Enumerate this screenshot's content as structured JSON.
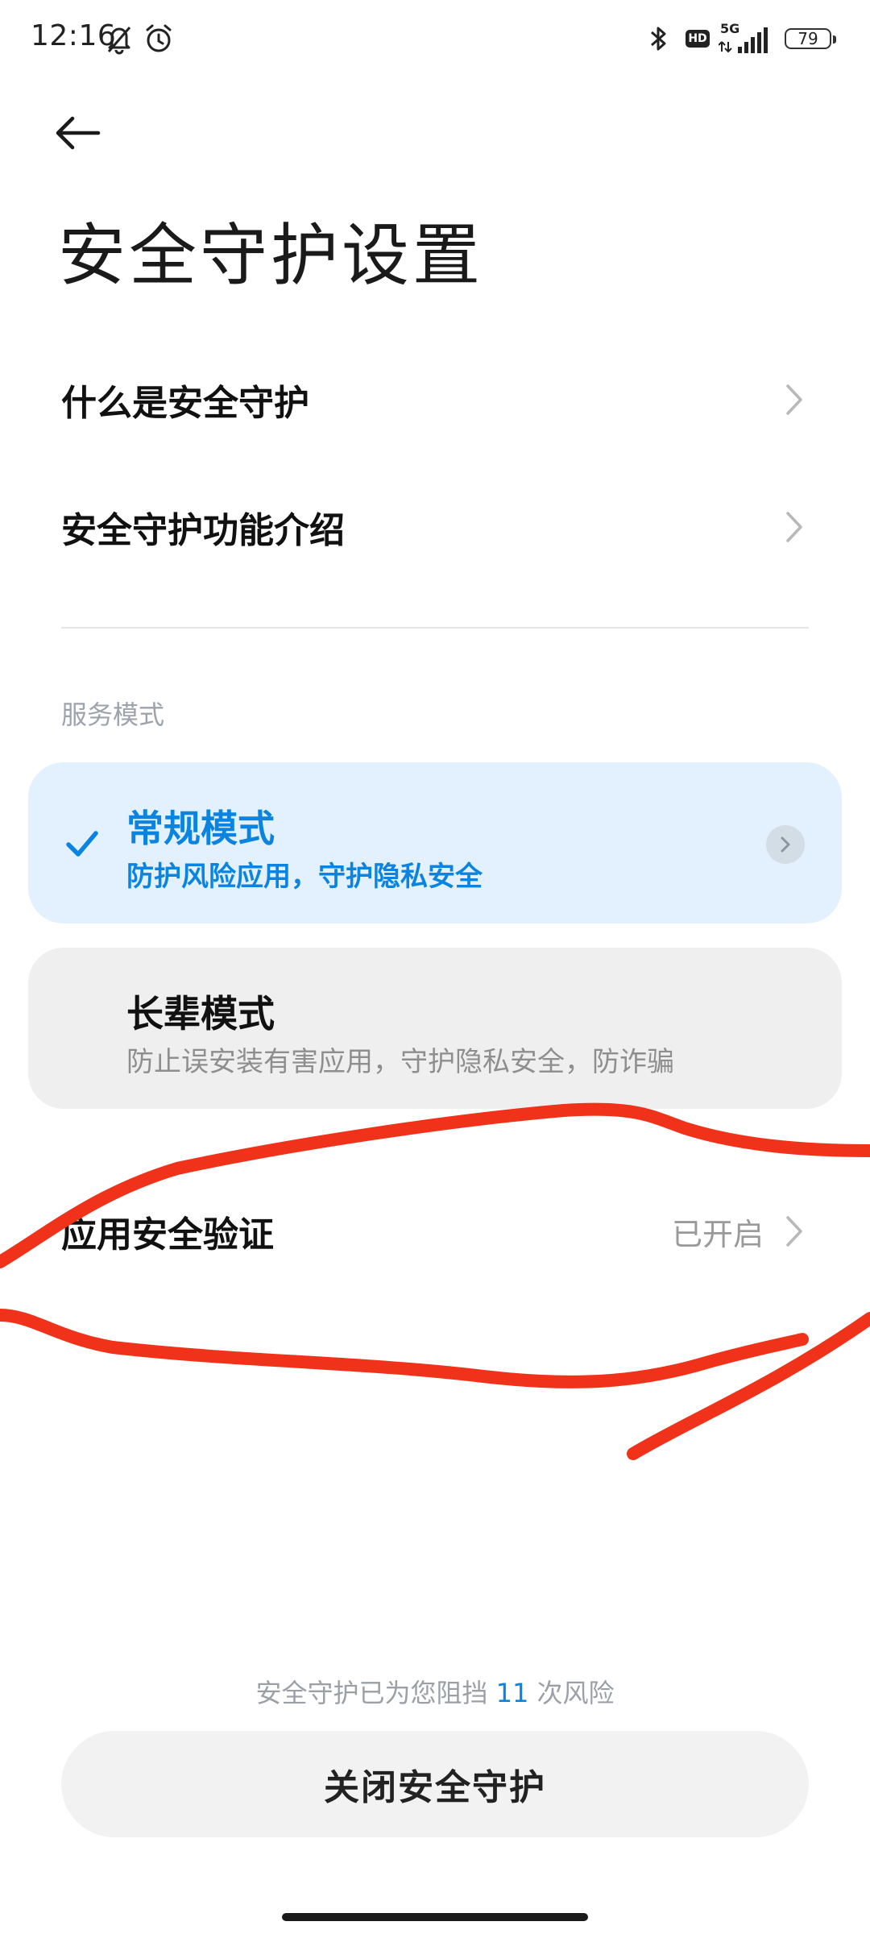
{
  "status_bar": {
    "time": "12:16",
    "network": "5G",
    "hd": "HD",
    "battery": "79",
    "icons": [
      "bell-muted-icon",
      "alarm-icon",
      "bluetooth-icon",
      "hd-icon",
      "signal-icon",
      "battery-icon"
    ]
  },
  "header": {
    "title": "安全守护设置",
    "back_icon": "back-arrow-icon"
  },
  "menu": [
    {
      "label": "什么是安全守护"
    },
    {
      "label": "安全守护功能介绍"
    }
  ],
  "section_label": "服务模式",
  "modes": [
    {
      "title": "常规模式",
      "desc": "防护风险应用，守护隐私安全",
      "selected": true
    },
    {
      "title": "长辈模式",
      "desc": "防止误安装有害应用，守护隐私安全，防诈骗",
      "selected": false
    }
  ],
  "app_verify": {
    "label": "应用安全验证",
    "value": "已开启"
  },
  "footer": {
    "stats_prefix": "安全守护已为您阻挡 ",
    "stats_count": "11",
    "stats_suffix": " 次风险",
    "close_button": "关闭安全守护"
  },
  "colors": {
    "accent": "#0a84e0",
    "selected_card_bg": "#e2f1fd",
    "unselected_card_bg": "#efefef",
    "scribble": "#f0321a"
  }
}
